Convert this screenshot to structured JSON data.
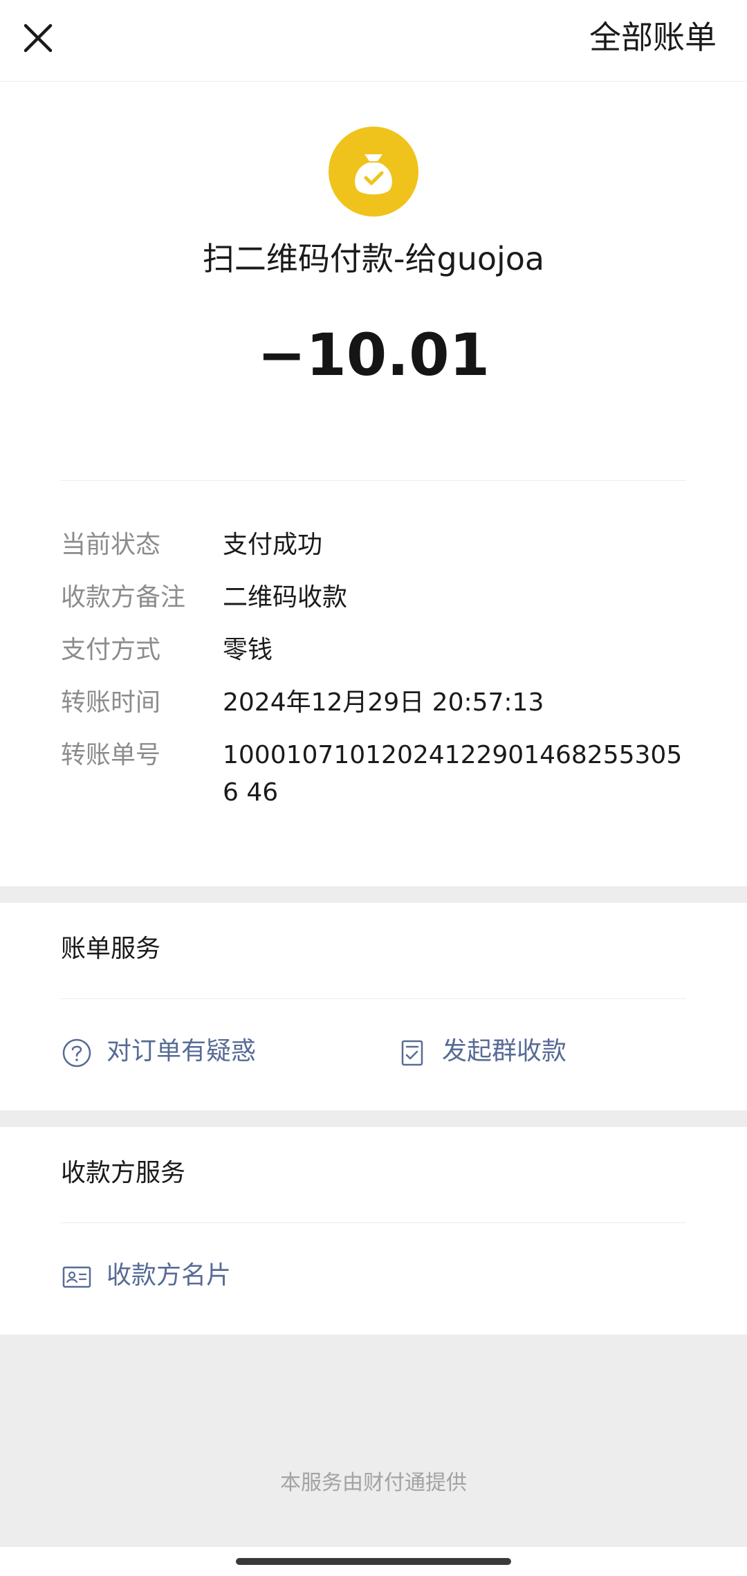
{
  "header": {
    "close_icon": "close-icon",
    "all_bills_label": "全部账单"
  },
  "transaction": {
    "merchant_icon": "money-bag-check-icon",
    "merchant_icon_color": "#efc31b",
    "title": "扫二维码付款-给guojoa",
    "amount": "−10.01",
    "details": [
      {
        "label": "当前状态",
        "value": "支付成功"
      },
      {
        "label": "收款方备注",
        "value": "二维码收款"
      },
      {
        "label": "支付方式",
        "value": "零钱"
      },
      {
        "label": "转账时间",
        "value": "2024年12月29日 20:57:13"
      },
      {
        "label": "转账单号",
        "value": "100010710120241229014682553056 46"
      }
    ]
  },
  "bill_services": {
    "title": "账单服务",
    "items": [
      {
        "icon": "question-circle-icon",
        "label": "对订单有疑惑"
      },
      {
        "icon": "checklist-icon",
        "label": "发起群收款"
      }
    ]
  },
  "payee_services": {
    "title": "收款方服务",
    "items": [
      {
        "icon": "business-card-icon",
        "label": "收款方名片"
      }
    ]
  },
  "footer": {
    "text": "本服务由财付通提供"
  },
  "colors": {
    "link": "#576b95",
    "label_gray": "#8c8c8c",
    "background": "#ededed"
  }
}
